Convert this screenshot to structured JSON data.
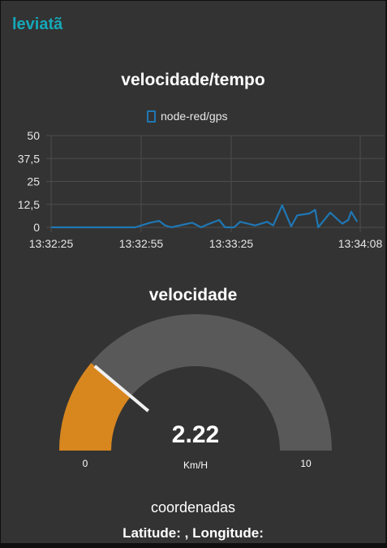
{
  "group": {
    "title": "leviatã"
  },
  "chart": {
    "title": "velocidade/tempo",
    "legend_label": "node-red/gps",
    "line_color": "#1f77b4"
  },
  "chart_data": {
    "type": "line",
    "title": "velocidade/tempo",
    "x_tick_labels": [
      "13:32:25",
      "13:32:55",
      "13:33:25",
      "13:34:08"
    ],
    "y_tick_labels": [
      "50",
      "37,5",
      "25",
      "12,5",
      "0"
    ],
    "ylim": [
      0,
      50
    ],
    "xlim_seconds": [
      0,
      103
    ],
    "grid": true,
    "legend": "top-center",
    "series": [
      {
        "name": "node-red/gps",
        "x": [
          0,
          28,
          33,
          36,
          38,
          40,
          47,
          50,
          52,
          56,
          58,
          61,
          63,
          68,
          72,
          74,
          77,
          80,
          82,
          86,
          88,
          89,
          93,
          97,
          99,
          100,
          102
        ],
        "y": [
          0,
          0,
          2.5,
          3.5,
          1,
          0,
          2.5,
          0,
          1.5,
          4,
          0,
          0,
          3,
          1,
          3,
          1,
          12,
          0.5,
          6.5,
          7.5,
          9.5,
          0,
          8,
          2,
          4,
          8.5,
          3
        ]
      }
    ]
  },
  "gauge": {
    "title": "velocidade",
    "value_text": "2.22",
    "value": 2.22,
    "min": 0,
    "max": 10,
    "min_label": "0",
    "max_label": "10",
    "units": "Km/H",
    "fill_color": "#d8861e",
    "track_color": "#595959"
  },
  "coords": {
    "title": "coordenadas",
    "value": "Latitude: , Longitude:"
  }
}
